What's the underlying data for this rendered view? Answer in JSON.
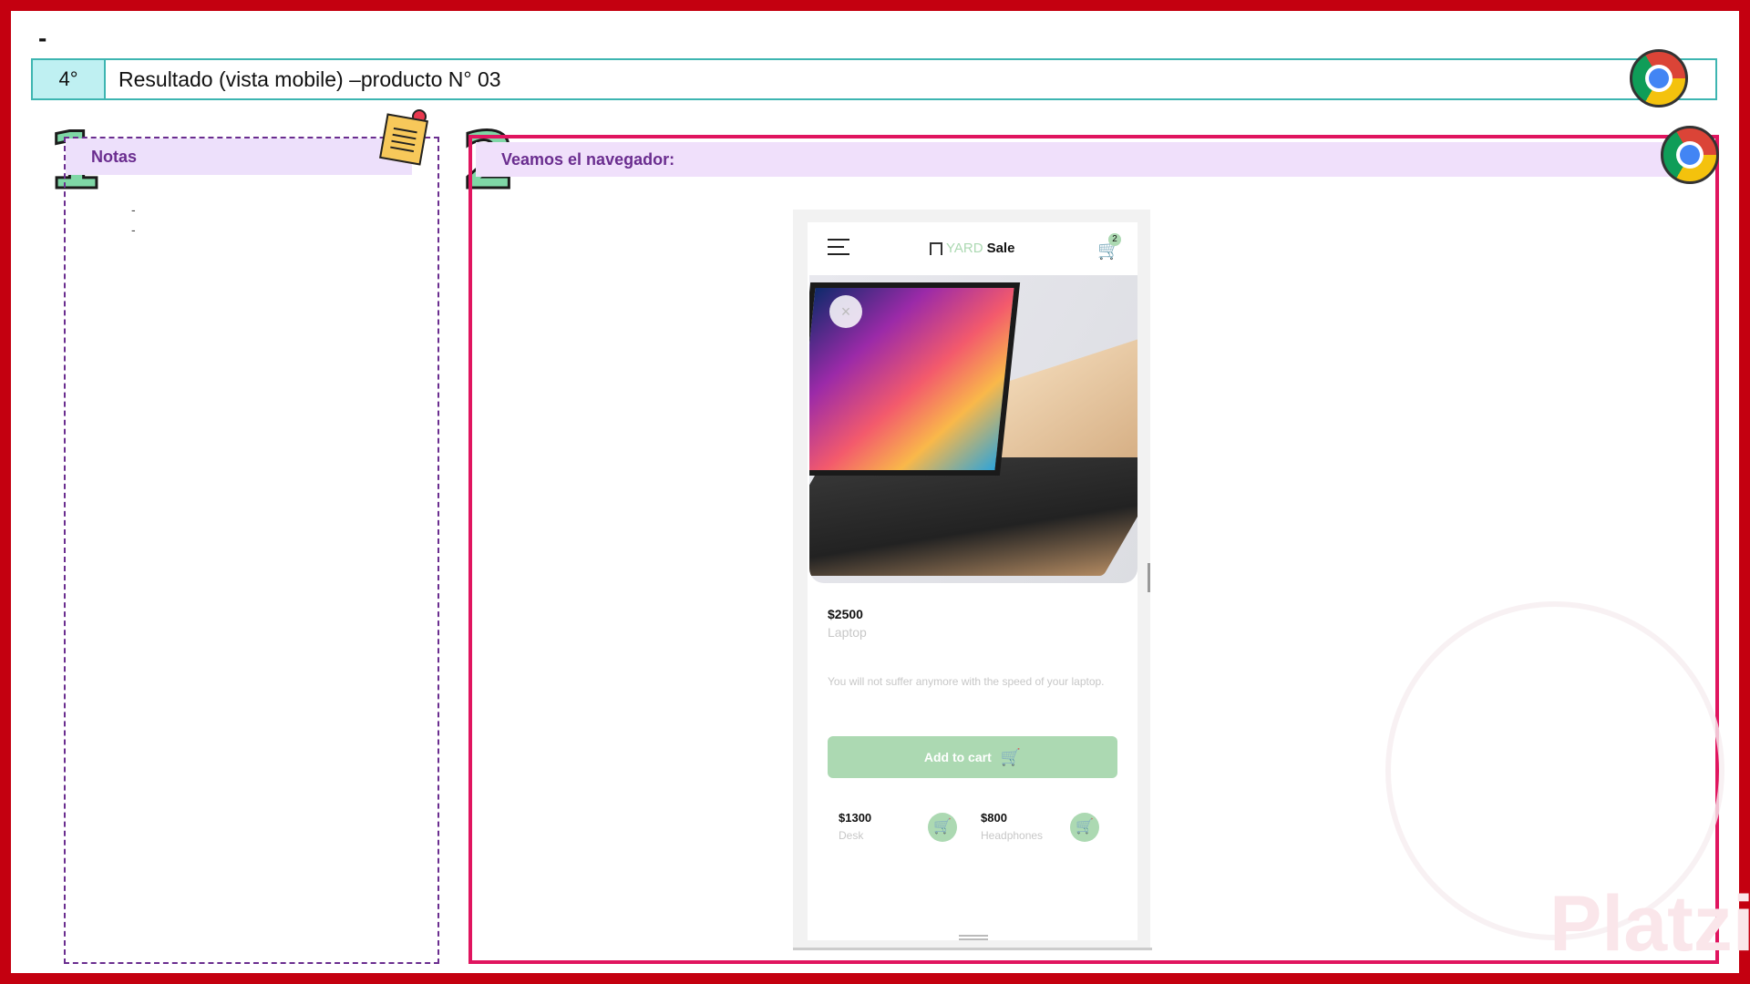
{
  "slide": {
    "top_dash": "-",
    "step": "4°",
    "title": "Resultado (vista mobile) –producto N° 03"
  },
  "notes": {
    "number": "1",
    "heading": "Notas",
    "lines": [
      "-",
      "-"
    ]
  },
  "browser": {
    "number": "2",
    "heading": "Veamos el navegador:"
  },
  "app": {
    "logo_yard": "YARD",
    "logo_sale": "Sale",
    "cart_count": "2",
    "close_symbol": "×",
    "product": {
      "price": "$2500",
      "name": "Laptop",
      "description": "You will not suffer anymore with the speed of your laptop.",
      "add_button": "Add to cart"
    },
    "related": [
      {
        "price": "$1300",
        "name": "Desk"
      },
      {
        "price": "$800",
        "name": "Headphones"
      }
    ]
  },
  "watermark": {
    "brand": "Platzi"
  },
  "icons": {
    "chrome": "chrome-icon",
    "menu": "menu-icon",
    "cart": "cart-icon",
    "sticky_note": "sticky-note-icon"
  },
  "colors": {
    "frame_red": "#c40010",
    "header_teal": "#3db5b1",
    "step_bg": "#bff0f2",
    "notes_purple": "#6a2d8f",
    "browser_pink": "#e0155f",
    "accent_green": "#acd9b2"
  }
}
